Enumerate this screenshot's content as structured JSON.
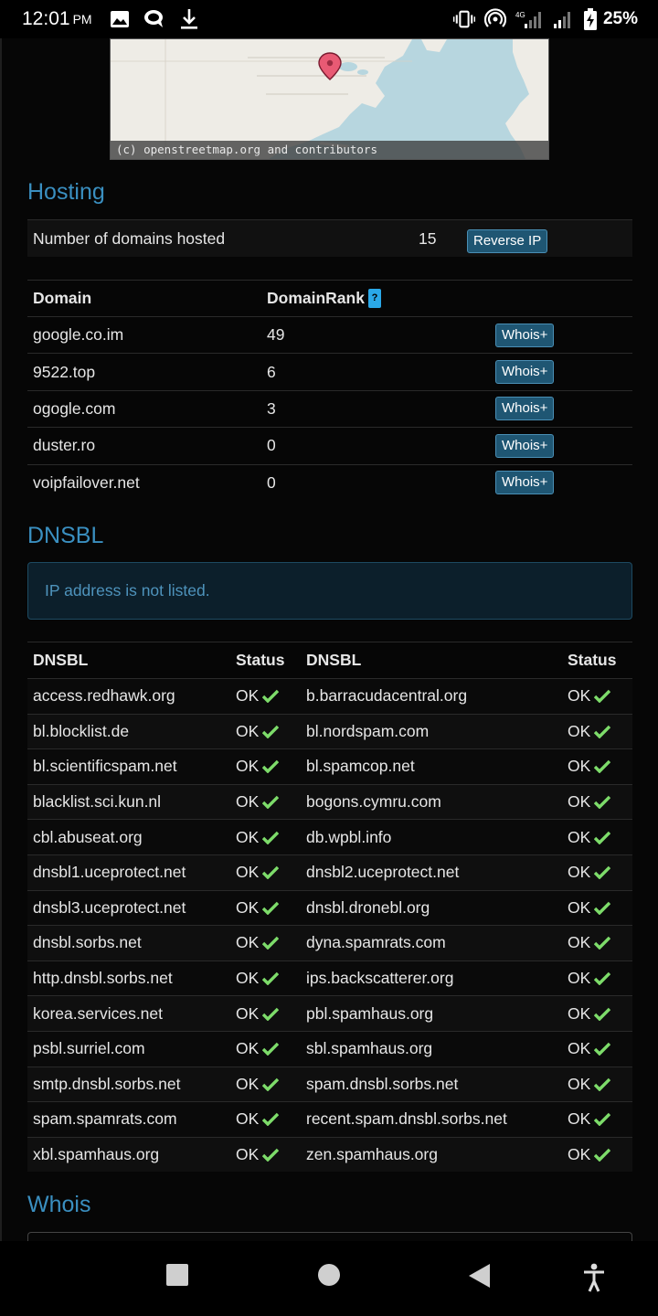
{
  "status_bar": {
    "time": "12:01",
    "ampm": "PM",
    "battery": "25%",
    "icons": [
      "image-icon",
      "chat-icon",
      "download-icon",
      "vibrate-icon",
      "hotspot-icon",
      "signal-4g-icon",
      "signal-icon",
      "battery-charging-icon"
    ]
  },
  "map": {
    "credit": "(c) openstreetmap.org and contributors"
  },
  "hosting": {
    "title": "Hosting",
    "domains_label": "Number of domains hosted",
    "domains_count": "15",
    "reverse_ip_label": "Reverse IP"
  },
  "domains_table": {
    "col_domain": "Domain",
    "col_rank": "DomainRank",
    "help_badge": "?",
    "whois_label": "Whois+",
    "rows": [
      {
        "domain": "google.co.im",
        "rank": "49"
      },
      {
        "domain": "9522.top",
        "rank": "6"
      },
      {
        "domain": "ogogle.com",
        "rank": "3"
      },
      {
        "domain": "duster.ro",
        "rank": "0"
      },
      {
        "domain": "voipfailover.net",
        "rank": "0"
      }
    ]
  },
  "dnsbl": {
    "title": "DNSBL",
    "notice": "IP address is not listed.",
    "col_dnsbl": "DNSBL",
    "col_status": "Status",
    "rows": [
      {
        "a": "access.redhawk.org",
        "a_status": "OK",
        "b": "b.barracudacentral.org",
        "b_status": "OK"
      },
      {
        "a": "bl.blocklist.de",
        "a_status": "OK",
        "b": "bl.nordspam.com",
        "b_status": "OK"
      },
      {
        "a": "bl.scientificspam.net",
        "a_status": "OK",
        "b": "bl.spamcop.net",
        "b_status": "OK"
      },
      {
        "a": "blacklist.sci.kun.nl",
        "a_status": "OK",
        "b": "bogons.cymru.com",
        "b_status": "OK"
      },
      {
        "a": "cbl.abuseat.org",
        "a_status": "OK",
        "b": "db.wpbl.info",
        "b_status": "OK"
      },
      {
        "a": "dnsbl1.uceprotect.net",
        "a_status": "OK",
        "b": "dnsbl2.uceprotect.net",
        "b_status": "OK"
      },
      {
        "a": "dnsbl3.uceprotect.net",
        "a_status": "OK",
        "b": "dnsbl.dronebl.org",
        "b_status": "OK"
      },
      {
        "a": "dnsbl.sorbs.net",
        "a_status": "OK",
        "b": "dyna.spamrats.com",
        "b_status": "OK"
      },
      {
        "a": "http.dnsbl.sorbs.net",
        "a_status": "OK",
        "b": "ips.backscatterer.org",
        "b_status": "OK"
      },
      {
        "a": "korea.services.net",
        "a_status": "OK",
        "b": "pbl.spamhaus.org",
        "b_status": "OK"
      },
      {
        "a": "psbl.surriel.com",
        "a_status": "OK",
        "b": "sbl.spamhaus.org",
        "b_status": "OK"
      },
      {
        "a": "smtp.dnsbl.sorbs.net",
        "a_status": "OK",
        "b": "spam.dnsbl.sorbs.net",
        "b_status": "OK"
      },
      {
        "a": "spam.spamrats.com",
        "a_status": "OK",
        "b": "recent.spam.dnsbl.sorbs.net",
        "b_status": "OK"
      },
      {
        "a": "xbl.spamhaus.org",
        "a_status": "OK",
        "b": "zen.spamhaus.org",
        "b_status": "OK"
      }
    ]
  },
  "whois": {
    "title": "Whois"
  },
  "colors": {
    "heading": "#3a8fc0",
    "check": "#7ddc6a",
    "button": "#1f5673"
  }
}
